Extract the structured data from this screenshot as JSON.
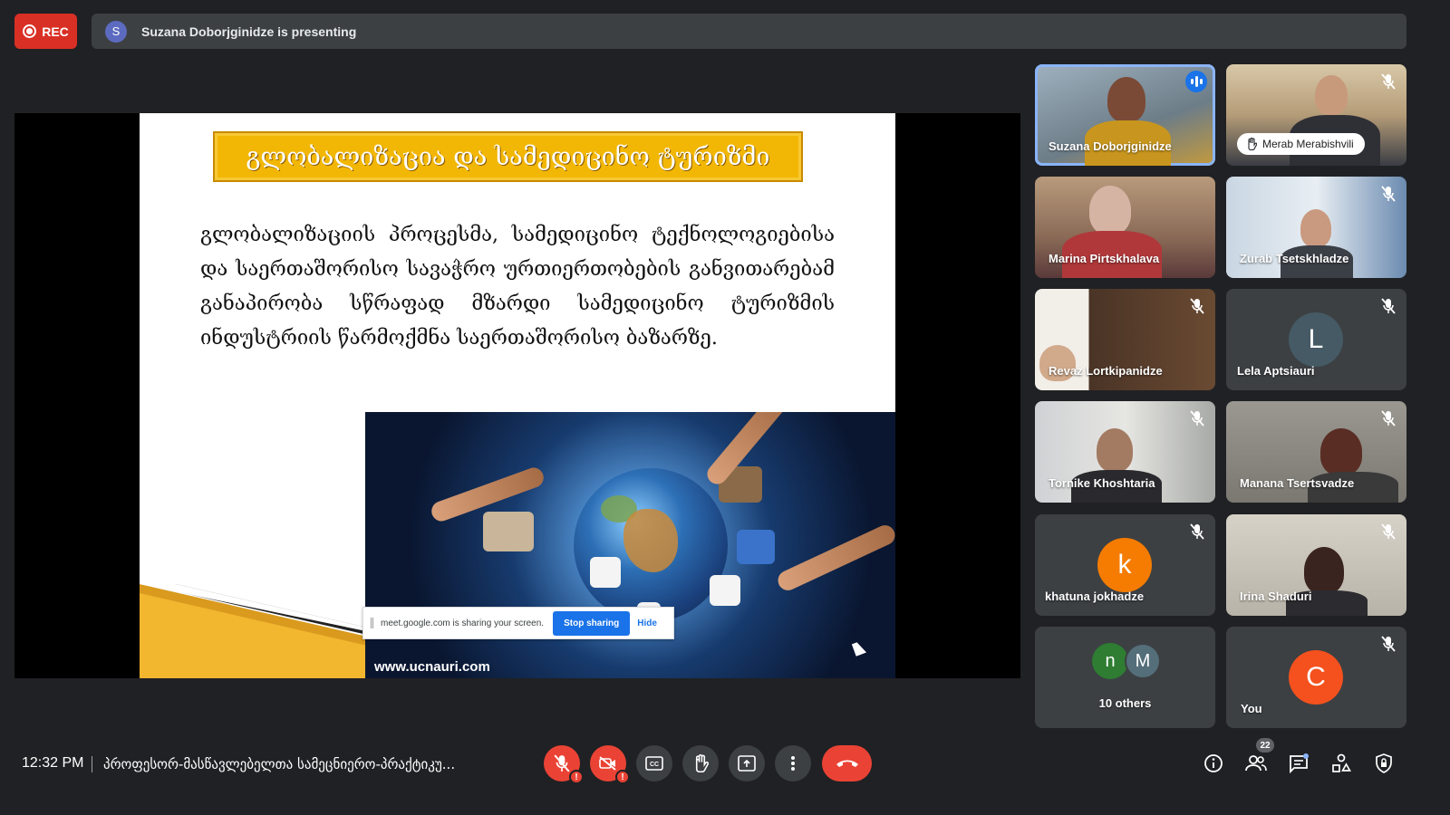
{
  "recording": {
    "label": "REC"
  },
  "presenting": {
    "avatar_letter": "S",
    "text": "Suzana Doborjginidze is presenting"
  },
  "slide": {
    "title": "გლობალიზაცია და სამედიცინო ტურიზმი",
    "body": "გლობალიზაციის პროცესმა, სამედიცინო ტექნოლოგიებისა და საერთაშორისო სავაჭრო ურთიერთობების განვითარებამ განაპირობა სწრაფად მზარდი სამედიცინო ტურიზმის ინდუსტრიის წარმოქმნა საერთაშორისო ბაზარზე.",
    "photo_url": "www.ucnauri.com"
  },
  "share_bar": {
    "message": "meet.google.com is sharing your screen.",
    "stop_label": "Stop sharing",
    "hide_label": "Hide"
  },
  "participants": [
    {
      "name": "Suzana Doborjginidze",
      "state": "speaking",
      "type": "video"
    },
    {
      "name": "Merab Merabishvili",
      "state": "muted",
      "type": "video",
      "hand_raised": true
    },
    {
      "name": "Marina Pirtskhalava",
      "state": "unmuted",
      "type": "video"
    },
    {
      "name": "Zurab Tsetskhladze",
      "state": "muted",
      "type": "video"
    },
    {
      "name": "Revaz Lortkipanidze",
      "state": "muted",
      "type": "video"
    },
    {
      "name": "Lela Aptsiauri",
      "state": "muted",
      "type": "avatar",
      "letter": "L",
      "color": "#455a64"
    },
    {
      "name": "Tornike Khoshtaria",
      "state": "muted",
      "type": "video"
    },
    {
      "name": "Manana Tsertsvadze",
      "state": "muted",
      "type": "video"
    },
    {
      "name": "khatuna jokhadze",
      "state": "muted",
      "type": "avatar",
      "letter": "k",
      "color": "#f57c00"
    },
    {
      "name": "Irina Shaduri",
      "state": "muted",
      "type": "video"
    },
    {
      "name": "You",
      "state": "muted",
      "type": "avatar",
      "letter": "C",
      "color": "#f4511e"
    }
  ],
  "others": {
    "label": "10 others",
    "avatars": [
      {
        "letter": "n",
        "color": "#2e7d32"
      },
      {
        "letter": "M",
        "color": "#546e7a"
      }
    ]
  },
  "bottom": {
    "time": "12:32 PM",
    "meeting_title": "პროფესორ-მასწავლებელთა სამეცნიერო-პრაქტიკუ...",
    "participant_count": "22",
    "colors": {
      "danger": "#ea4335",
      "accent": "#1a73e8",
      "control_bg": "#3c4043"
    }
  }
}
